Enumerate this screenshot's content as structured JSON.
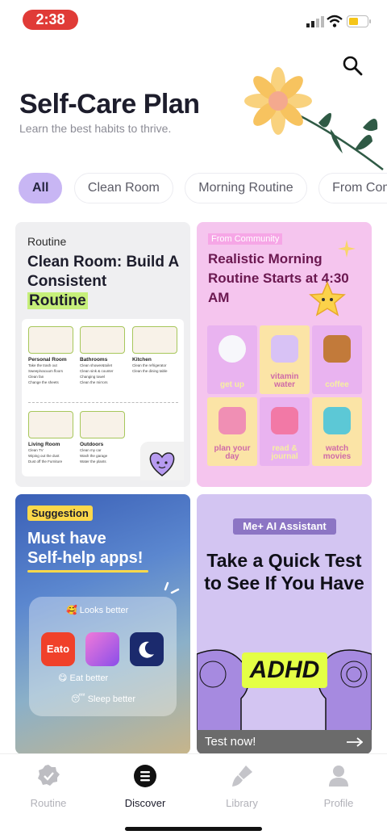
{
  "status": {
    "time": "2:38"
  },
  "header": {
    "title": "Self-Care Plan",
    "subtitle": "Learn the best habits to thrive."
  },
  "filters": [
    "All",
    "Clean Room",
    "Morning Routine",
    "From Comm"
  ],
  "cards": {
    "clean_room": {
      "kicker": "Routine",
      "title_a": "Clean Room: Build A Consistent",
      "title_b": "Routine",
      "rooms": [
        {
          "name": "Personal Room",
          "items": [
            "Take the trash out",
            "Sweep/vacuum floors",
            "Clean fan",
            "Change the sheets"
          ]
        },
        {
          "name": "Bathrooms",
          "items": [
            "Clean shower&toilet",
            "Clean sink & counter",
            "Changing towel",
            "Clean the mirrors"
          ]
        },
        {
          "name": "Kitchen",
          "items": [
            "Clean the refrigerator",
            "Clean the dining table"
          ]
        },
        {
          "name": "Living Room",
          "items": [
            "Clean TV",
            "Wiping out the dust",
            "Dust off the Furniture"
          ]
        },
        {
          "name": "Outdoors",
          "items": [
            "Clean my car",
            "Wash the garage",
            "Water the plants"
          ]
        }
      ]
    },
    "morning": {
      "tag": "From Community",
      "title": "Realistic Morning Routine Starts at 4:30 AM",
      "cells": [
        {
          "label": "get up",
          "bg": "#e9b3f0",
          "fg": "#f6f0a0"
        },
        {
          "label": "vitamin water",
          "bg": "#fbe4a6",
          "fg": "#cf6aa8"
        },
        {
          "label": "coffee",
          "bg": "#e9b3f0",
          "fg": "#f6f0a0"
        },
        {
          "label": "plan your day",
          "bg": "#fbe4a6",
          "fg": "#cf6aa8"
        },
        {
          "label": "read & journal",
          "bg": "#e9b3f0",
          "fg": "#f6f0a0"
        },
        {
          "label": "watch movies",
          "bg": "#fbe4a6",
          "fg": "#cf6aa8"
        }
      ]
    },
    "apps": {
      "tag": "Suggestion",
      "title_a": "Must have",
      "title_b": "Self-help apps!",
      "app_name": "Eato",
      "labels": [
        "🥰 Looks better",
        "😋 Eat better",
        "😴 Sleep better"
      ]
    },
    "adhd": {
      "tag": "Me+ AI Assistant",
      "title": "Take a Quick Test to See If You Have",
      "highlight": "ADHD",
      "button": "Test now!"
    }
  },
  "nav": [
    {
      "label": "Routine",
      "icon": "badge-check-icon"
    },
    {
      "label": "Discover",
      "icon": "discover-icon"
    },
    {
      "label": "Library",
      "icon": "brush-icon"
    },
    {
      "label": "Profile",
      "icon": "person-icon"
    }
  ],
  "colors": {
    "accent": "#c8b6f4",
    "highlight": "#c6ef7a",
    "status_pill": "#e03b37"
  }
}
